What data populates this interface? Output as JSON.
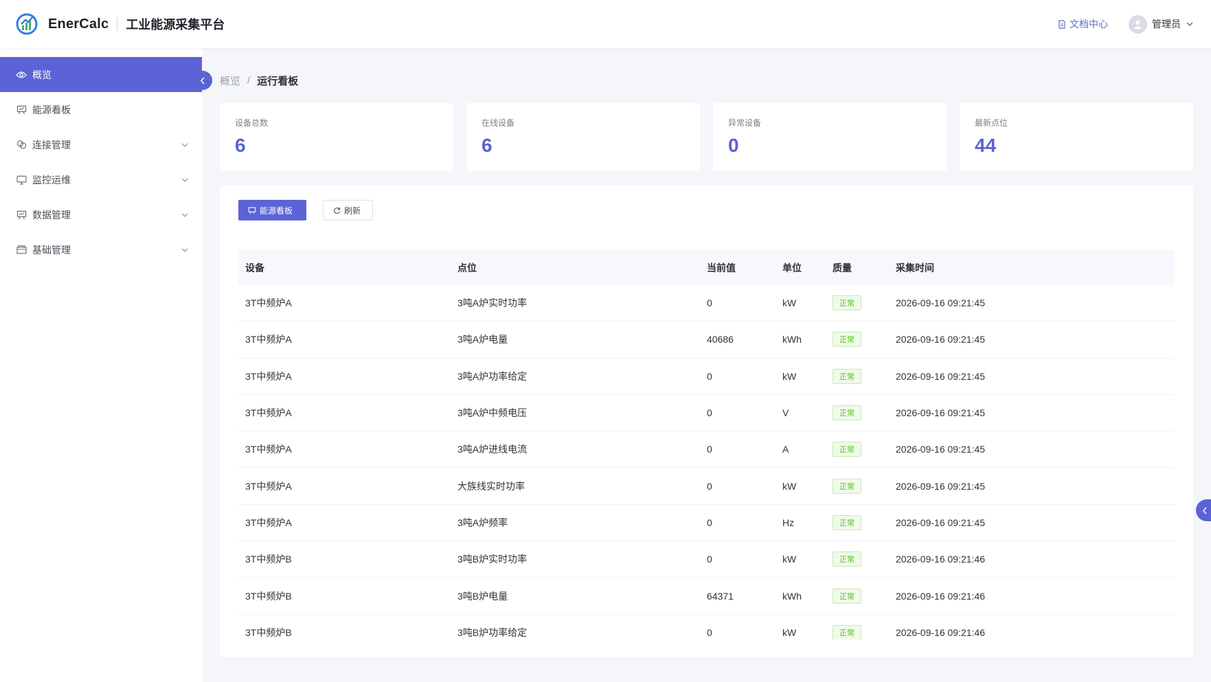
{
  "header": {
    "brand": "EnerCalc",
    "platform": "工业能源采集平台",
    "docs_label": "文档中心",
    "user_label": "管理员"
  },
  "sidebar": {
    "items": [
      {
        "label": "概览",
        "icon": "eye-icon",
        "active": true
      },
      {
        "label": "能源看板",
        "icon": "board-icon"
      },
      {
        "label": "连接管理",
        "icon": "link-icon",
        "expandable": true
      },
      {
        "label": "监控运维",
        "icon": "monitor-icon",
        "expandable": true
      },
      {
        "label": "数据管理",
        "icon": "board-icon",
        "expandable": true
      },
      {
        "label": "基础管理",
        "icon": "folder-icon",
        "expandable": true
      }
    ]
  },
  "breadcrumb": {
    "home": "概览",
    "separator": "/",
    "current": "运行看板"
  },
  "stats": [
    {
      "label": "设备总数",
      "value": "6"
    },
    {
      "label": "在线设备",
      "value": "6"
    },
    {
      "label": "异常设备",
      "value": "0"
    },
    {
      "label": "最新点位",
      "value": "44"
    }
  ],
  "toolbar": {
    "primary_label": "能源看板",
    "refresh_label": "刷新"
  },
  "table": {
    "columns": [
      "设备",
      "点位",
      "当前值",
      "单位",
      "质量",
      "采集时间"
    ],
    "rows": [
      [
        "3T中频炉A",
        "3吨A炉实时功率",
        "0",
        "kW",
        "正常",
        "2026-09-16 09:21:45"
      ],
      [
        "3T中频炉A",
        "3吨A炉电量",
        "40686",
        "kWh",
        "正常",
        "2026-09-16 09:21:45"
      ],
      [
        "3T中频炉A",
        "3吨A炉功率给定",
        "0",
        "kW",
        "正常",
        "2026-09-16 09:21:45"
      ],
      [
        "3T中频炉A",
        "3吨A炉中频电压",
        "0",
        "V",
        "正常",
        "2026-09-16 09:21:45"
      ],
      [
        "3T中频炉A",
        "3吨A炉进线电流",
        "0",
        "A",
        "正常",
        "2026-09-16 09:21:45"
      ],
      [
        "3T中频炉A",
        "大族线实时功率",
        "0",
        "kW",
        "正常",
        "2026-09-16 09:21:45"
      ],
      [
        "3T中频炉A",
        "3吨A炉频率",
        "0",
        "Hz",
        "正常",
        "2026-09-16 09:21:45"
      ],
      [
        "3T中频炉B",
        "3吨B炉实时功率",
        "0",
        "kW",
        "正常",
        "2026-09-16 09:21:46"
      ],
      [
        "3T中频炉B",
        "3吨B炉电量",
        "64371",
        "kWh",
        "正常",
        "2026-09-16 09:21:46"
      ],
      [
        "3T中频炉B",
        "3吨B炉功率给定",
        "0",
        "kW",
        "正常",
        "2026-09-16 09:21:46"
      ]
    ]
  },
  "colors": {
    "accent": "#5b63d6",
    "ok": "#52c41a"
  }
}
